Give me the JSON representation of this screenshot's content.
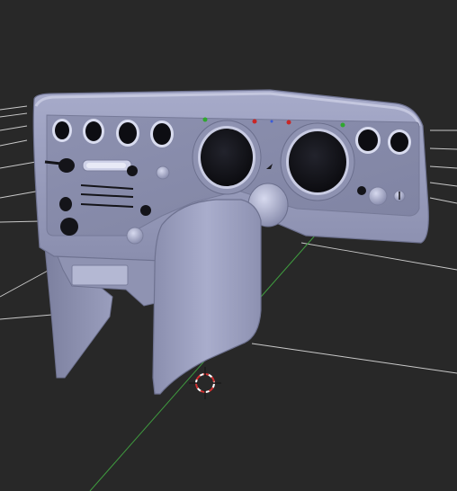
{
  "viewport": {
    "view_type": "3d-viewport",
    "background_color": "#282828",
    "grid_color": "#e6e6e6",
    "axis_y_color": "#3f9a3f",
    "model_color": "#9b9fbe",
    "cursor_icon": "3d-cursor-icon"
  },
  "dashboard": {
    "indicator_lights": [
      {
        "name": "green-indicator-left",
        "color": "#2fa82f"
      },
      {
        "name": "red-indicator-1",
        "color": "#c92727"
      },
      {
        "name": "blue-indicator",
        "color": "#3b5bd8"
      },
      {
        "name": "red-indicator-2",
        "color": "#c92727"
      },
      {
        "name": "green-indicator-right",
        "color": "#2fa82f"
      }
    ]
  }
}
